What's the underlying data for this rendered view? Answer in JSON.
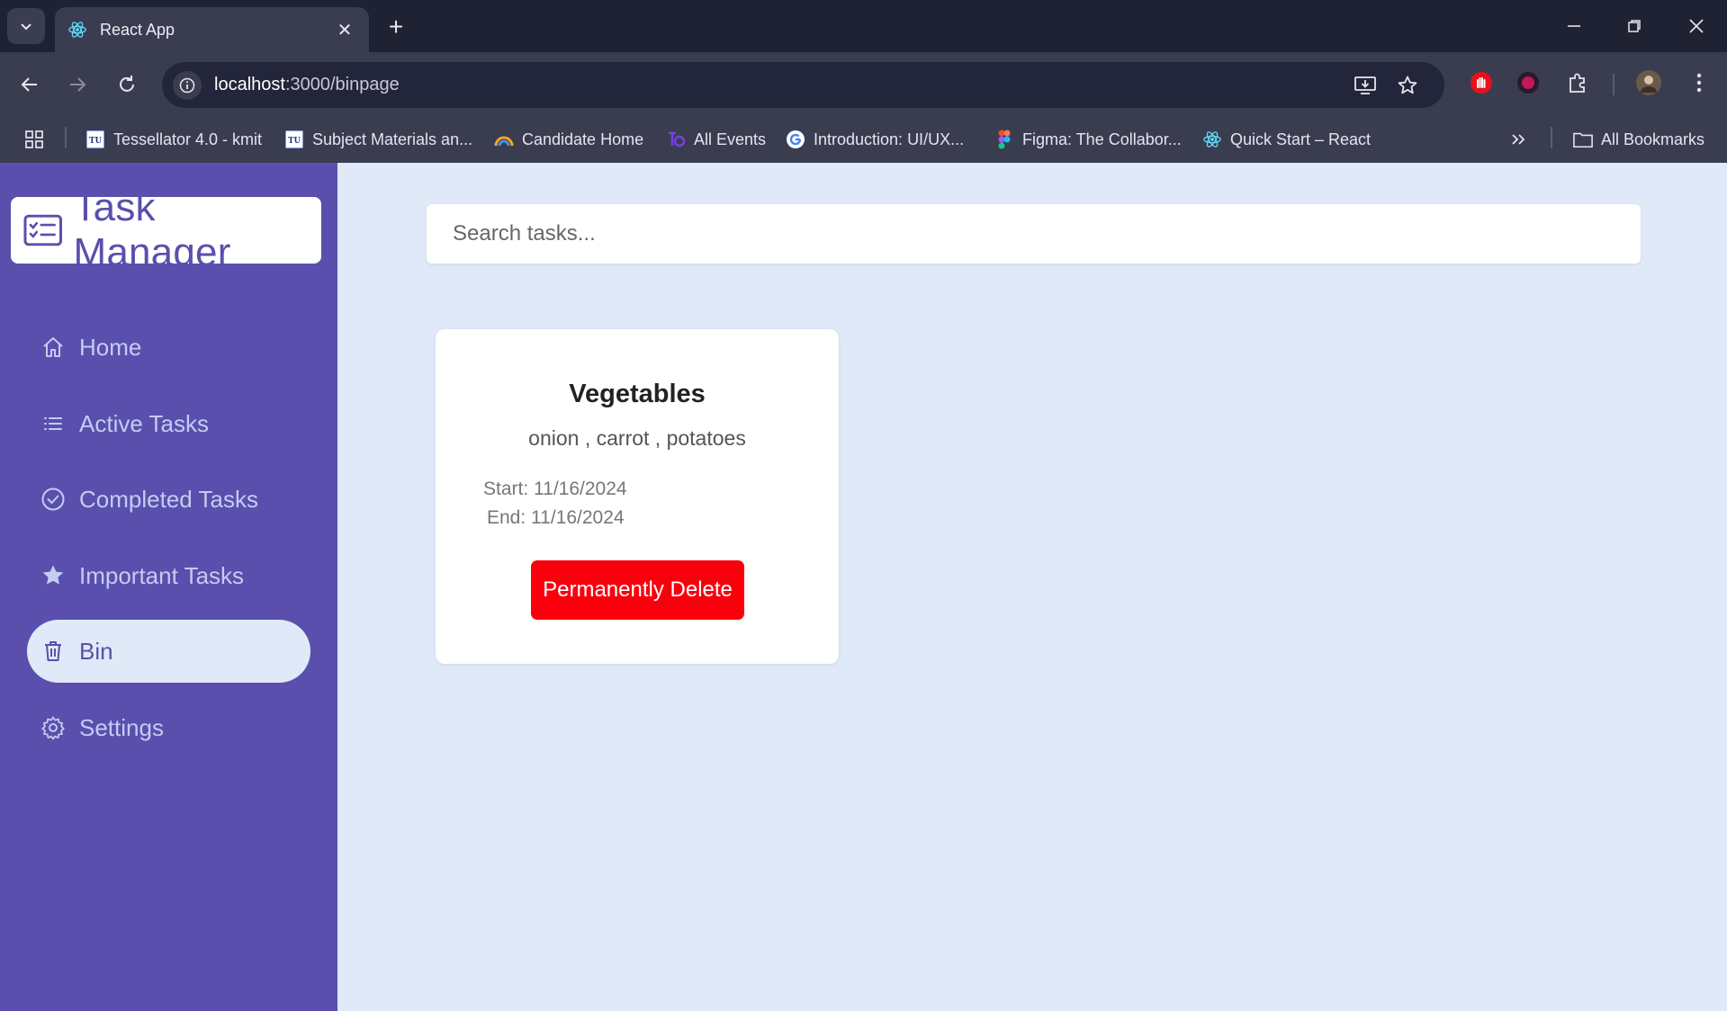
{
  "browser": {
    "tab_title": "React App",
    "url_host": "localhost",
    "url_path": ":3000/binpage",
    "bookmarks": [
      {
        "label": "Tessellator 4.0 - kmit",
        "icon": "tu-logo-icon"
      },
      {
        "label": "Subject Materials an...",
        "icon": "tu-logo-icon"
      },
      {
        "label": "Candidate Home",
        "icon": "rainbow-icon"
      },
      {
        "label": "All Events",
        "icon": "events-icon"
      },
      {
        "label": "Introduction: UI/UX...",
        "icon": "google-icon"
      },
      {
        "label": "Figma: The Collabor...",
        "icon": "figma-icon"
      },
      {
        "label": "Quick Start – React",
        "icon": "react-icon"
      }
    ],
    "all_bookmarks": "All Bookmarks"
  },
  "app": {
    "brand": "Task Manager",
    "nav": [
      {
        "label": "Home",
        "icon": "home-icon"
      },
      {
        "label": "Active Tasks",
        "icon": "list-icon"
      },
      {
        "label": "Completed Tasks",
        "icon": "check-circle-icon"
      },
      {
        "label": "Important Tasks",
        "icon": "star-icon"
      },
      {
        "label": "Bin",
        "icon": "trash-icon",
        "active": true
      },
      {
        "label": "Settings",
        "icon": "gear-icon"
      }
    ],
    "search_placeholder": "Search tasks...",
    "tasks": [
      {
        "title": "Vegetables",
        "description": "onion , carrot , potatoes",
        "start": "Start: 11/16/2024",
        "end": "End: 11/16/2024",
        "action": "Permanently Delete"
      }
    ]
  },
  "colors": {
    "sidebar": "#5a4fad",
    "content_bg": "#dfe9f8",
    "delete_button": "#fa000d",
    "chrome_dark": "#1f2233",
    "chrome_toolbar": "#3a3d50"
  }
}
